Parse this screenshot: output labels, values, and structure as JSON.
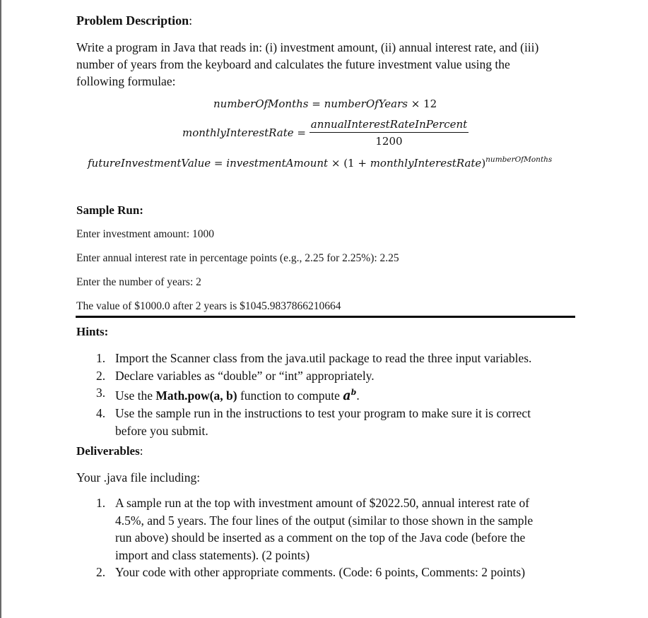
{
  "problem": {
    "heading": "Problem Description",
    "heading_colon": ":",
    "line1": "Write a program in Java that reads in: (i) investment amount, (ii) annual interest rate, and (iii)",
    "line2": "number of years from the keyboard and calculates the future investment value using the",
    "line3": "following formulae:"
  },
  "formulas": {
    "f1": {
      "lhs": "numberOfMonths",
      "rhs_var": "numberOfYears",
      "op_eq": "=",
      "op_times": "×",
      "constant": "12"
    },
    "f2": {
      "lhs": "monthlyInterestRate",
      "op_eq": "=",
      "numerator": "annualInterestRateInPercent",
      "denominator": "1200"
    },
    "f3": {
      "lhs": "futureInvestmentValue",
      "op_eq": "=",
      "var": "investmentAmount",
      "op_times": "×",
      "paren_open": "(1 + ",
      "inner_var": "monthlyInterestRate",
      "paren_close": ")",
      "exponent": "numberOfMonths"
    }
  },
  "sample_run": {
    "heading": "Sample Run:",
    "lines": [
      "Enter investment amount: 1000",
      "Enter annual interest rate in percentage points (e.g., 2.25 for 2.25%): 2.25",
      "Enter the number of years: 2",
      "The value of $1000.0 after 2 years is $1045.9837866210664"
    ]
  },
  "hints": {
    "heading": "Hints:",
    "items": [
      {
        "num": "1.",
        "text": "Import the Scanner class from the java.util package to read the three input variables."
      },
      {
        "num": "2.",
        "text": "Declare variables as “double” or “int” appropriately."
      },
      {
        "num": "3.",
        "pre": "Use the ",
        "bold": "Math.pow(a, b)",
        "post": " function to compute ",
        "math_base": "a",
        "math_exp": "b",
        "end": "."
      },
      {
        "num": "4.",
        "text_line1": "Use the sample run in the instructions to test your program to make sure it is correct",
        "text_line2": "before you submit."
      }
    ]
  },
  "deliverables": {
    "heading": "Deliverables",
    "heading_colon": ":",
    "intro": "Your .java file including:",
    "items": [
      {
        "num": "1.",
        "lines": [
          "A sample run at the top with investment amount of $2022.50, annual interest rate of",
          "4.5%, and 5 years. The four lines of the output (similar to those shown in the sample",
          "run above) should be inserted as a comment on the top of the Java code (before the",
          "import and class statements). (2 points)"
        ]
      },
      {
        "num": "2.",
        "lines": [
          "Your code with other appropriate comments. (Code: 6 points, Comments: 2 points)"
        ]
      }
    ]
  }
}
